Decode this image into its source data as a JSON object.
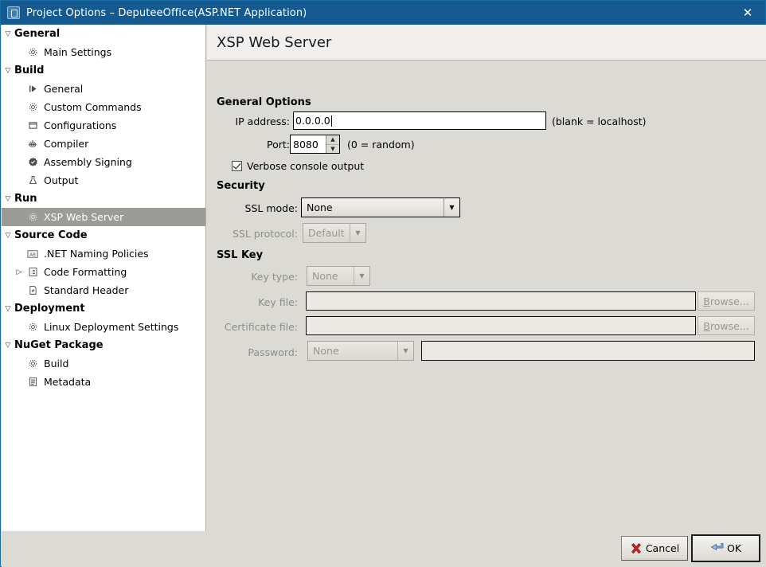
{
  "window": {
    "title": "Project Options – DeputeeOffice(ASP.NET Application)",
    "app_icon": "project-icon",
    "close_icon": "✕"
  },
  "sidebar": {
    "groups": [
      {
        "label": "General",
        "expander": "▽",
        "items": [
          {
            "label": "Main Settings",
            "icon": "gear-icon"
          }
        ]
      },
      {
        "label": "Build",
        "expander": "▽",
        "items": [
          {
            "label": "General",
            "icon": "run-icon"
          },
          {
            "label": "Custom Commands",
            "icon": "gear-icon"
          },
          {
            "label": "Configurations",
            "icon": "window-icon"
          },
          {
            "label": "Compiler",
            "icon": "robot-icon"
          },
          {
            "label": "Assembly Signing",
            "icon": "badge-icon"
          },
          {
            "label": "Output",
            "icon": "flask-icon"
          }
        ]
      },
      {
        "label": "Run",
        "expander": "▽",
        "items": [
          {
            "label": "XSP Web Server",
            "icon": "gear-icon",
            "selected": true
          }
        ]
      },
      {
        "label": "Source Code",
        "expander": "▽",
        "items": [
          {
            "label": ".NET Naming Policies",
            "icon": "ab-icon"
          },
          {
            "label": "Code Formatting",
            "icon": "list-icon",
            "expander": "▷"
          },
          {
            "label": "Standard Header",
            "icon": "hash-doc-icon"
          }
        ]
      },
      {
        "label": "Deployment",
        "expander": "▽",
        "items": [
          {
            "label": "Linux Deployment Settings",
            "icon": "gear-icon"
          }
        ]
      },
      {
        "label": "NuGet Package",
        "expander": "▽",
        "items": [
          {
            "label": "Build",
            "icon": "gear-icon"
          },
          {
            "label": "Metadata",
            "icon": "doc-icon"
          }
        ]
      }
    ]
  },
  "main": {
    "title": "XSP Web Server",
    "general_options": {
      "heading": "General Options",
      "ip_label": "IP address:",
      "ip_value": "0.0.0.0",
      "ip_hint": "(blank = localhost)",
      "port_label": "Port:",
      "port_value": "8080",
      "port_hint": "(0 = random)",
      "verbose_label": "Verbose console output",
      "verbose_checked": true
    },
    "security": {
      "heading": "Security",
      "ssl_mode_label": "SSL mode:",
      "ssl_mode_value": "None",
      "ssl_protocol_label": "SSL protocol:",
      "ssl_protocol_value": "Default",
      "ssl_protocol_disabled": true
    },
    "ssl_key": {
      "heading": "SSL Key",
      "key_type_label": "Key type:",
      "key_type_value": "None",
      "key_file_label": "Key file:",
      "key_file_value": "",
      "key_file_browse": "Browse...",
      "cert_file_label": "Certificate file:",
      "cert_file_value": "",
      "cert_file_browse": "Browse...",
      "password_label": "Password:",
      "password_mode_value": "None",
      "password_value": ""
    }
  },
  "footer": {
    "cancel_label": "Cancel",
    "cancel_mnemonic": "C",
    "cancel_icon": "red-x-icon",
    "ok_label": "OK",
    "ok_mnemonic": "O",
    "ok_icon": "enter-arrow-icon"
  },
  "colors": {
    "titlebar": "#14598f",
    "body": "#dcdad5",
    "header": "#f0efed",
    "selection": "#9b9b98",
    "accent_red": "#cc2222",
    "accent_blue": "#5b8fc9"
  }
}
